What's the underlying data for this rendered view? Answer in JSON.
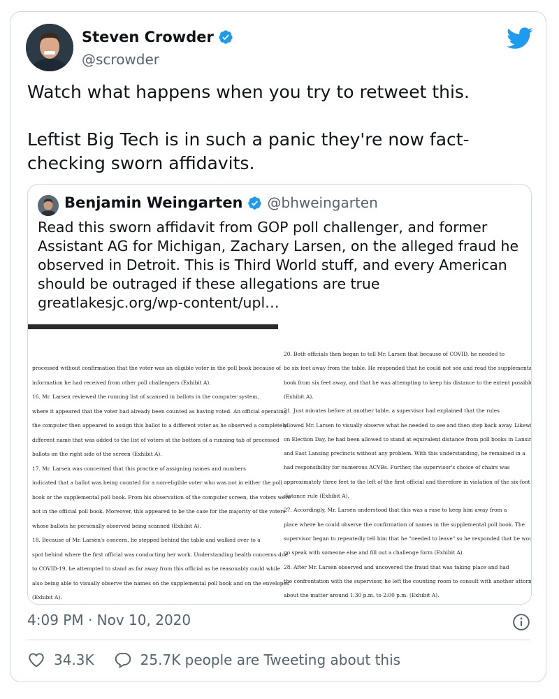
{
  "tweet": {
    "author_name": "Steven Crowder",
    "author_handle": "@scrowder",
    "text_line1": "Watch what happens when you try to retweet this.",
    "text_line2": "Leftist Big Tech is in such a panic they're now fact-checking sworn affidavits.",
    "timestamp": "4:09 PM · Nov 10, 2020",
    "likes": "34.3K",
    "replies_text": "25.7K people are Tweeting about this"
  },
  "quoted": {
    "author_name": "Benjamin Weingarten",
    "author_handle": "@bhweingarten",
    "text": "Read this sworn affidavit from GOP poll challenger, and former Assistant AG for Michigan, Zachary Larsen, on the alleged fraud he observed in Detroit. This is Third World stuff, and every American should be outraged if these allegations are true",
    "link": "greatlakesjc.org/wp-content/upl…"
  },
  "document": {
    "left_column": [
      "processed without confirmation that the voter was an eligible voter in the poll book because of",
      "information he had received from other poll challengers (Exhibit A).",
      "16.      Mr. Larsen reviewed the running list of scanned in ballots in the computer system,",
      "where it appeared that the voter had already been counted as having voted. An official operating",
      "the computer then appeared to assign this ballot to a different voter as he observed a completely",
      "different name that was added to the list of voters at the bottom of a running tab of processed",
      "ballots on the right side of the screen (Exhibit A).",
      "17.      Mr. Larsen was concerned that this practice of assigning names and numbers",
      "indicated that a ballot was being counted for a non-eligible voter who was not in either the poll",
      "book or the supplemental poll book. From his observation of the computer screen, the voters were",
      "not in the official poll book. Moreover, this appeared to be the case for the majority of the voters",
      "whose ballots he personally observed being scanned (Exhibit A).",
      "18.      Because of Mr. Larsen's concern, he stepped behind the table and walked over to a",
      "spot behind where the first official was conducting her work. Understanding health concerns due",
      "to COVID-19, he attempted to stand as far away from this official as he reasonably could while",
      "also being able to visually observe the names on the supplemental poll book and on the envelopes",
      "(Exhibit A)."
    ],
    "right_column": [
      "20.      Both officials then began to tell Mr. Larsen that because of COVID, he needed to",
      "be six feet away from the table. He responded that he could not see and read the supplemental poll",
      "book from six feet away, and that he was attempting to keep his distance to the extent possible",
      "(Exhibit A).",
      "21.      Just minutes before at another table, a supervisor had explained that the rules",
      "allowed Mr. Larsen to visually observe what he needed to see and then step back away. Likewise,",
      "on Election Day, he had been allowed to stand at equivalent distance from poll books in Lansing",
      "and East Lansing precincts without any problem. With this understanding, he remained in a",
      "had responsibility for numerous ACVBs. Further, the supervisor's choice of chairs was",
      "approximately three feet to the left of the first official and therefore in violation of the six-foot",
      "distance rule (Exhibit A).",
      "27.      Accordingly, Mr. Larsen understood that this was a ruse to keep him away from a",
      "place where he could observe the confirmation of names in the supplemental poll book. The",
      "supervisor began to repeatedly tell him that he \"needed to leave\" so he responded that he would",
      "go speak with someone else and fill out a challenge form (Exhibit A).",
      "28.      After Mr. Larsen observed and uncovered the fraud that was taking place and had",
      "the confrontation with the supervisor, he left the counting room to consult with another attorney",
      "about the matter around 1:30 p.m. to 2:00 p.m. (Exhibit A)."
    ]
  },
  "colors": {
    "verified_blue": "#1d9bf0",
    "twitter_blue": "#1d9bf0",
    "secondary_text": "#536471",
    "border": "#cfd9de"
  },
  "icons": {
    "verified": "verified-badge-icon",
    "logo": "twitter-bird-icon",
    "info": "info-circle-icon",
    "like": "heart-outline-icon",
    "reply": "speech-bubble-icon"
  }
}
